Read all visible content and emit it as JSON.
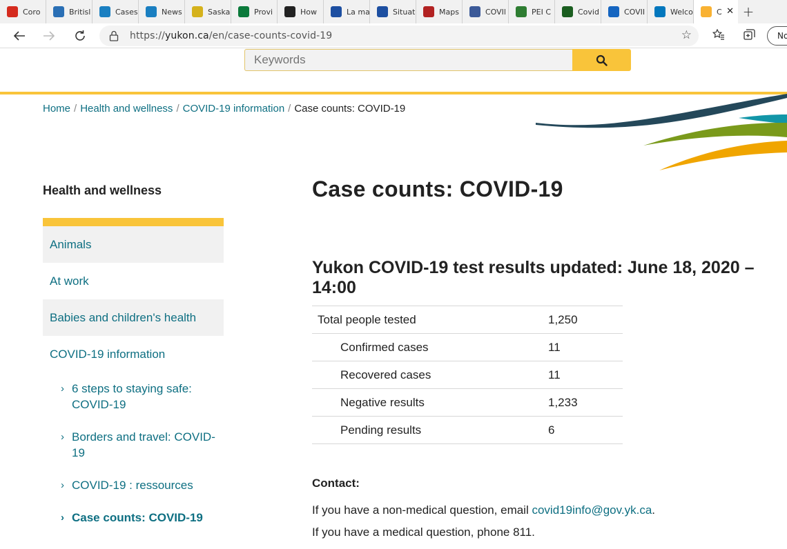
{
  "browser": {
    "tabs": [
      {
        "label": "Coro",
        "icon": "maple-leaf-icon",
        "color": "#d52b1e"
      },
      {
        "label": "Britisl",
        "icon": "bc-icon",
        "color": "#2a6fb5"
      },
      {
        "label": "Cases",
        "icon": "alberta-icon",
        "color": "#1a7fc1"
      },
      {
        "label": "News",
        "icon": "alberta-icon",
        "color": "#1a7fc1"
      },
      {
        "label": "Saska",
        "icon": "saskatchewan-icon",
        "color": "#d5b21c"
      },
      {
        "label": "Provi",
        "icon": "manitoba-icon",
        "color": "#0b7a3b"
      },
      {
        "label": "How",
        "icon": "ontario-icon",
        "color": "#222222"
      },
      {
        "label": "La ma",
        "icon": "quebec-icon",
        "color": "#1d4fa1"
      },
      {
        "label": "Situat",
        "icon": "quebec-icon",
        "color": "#1d4fa1"
      },
      {
        "label": "Maps",
        "icon": "new-brunswick-icon",
        "color": "#b22222"
      },
      {
        "label": "COVIl",
        "icon": "nova-scotia-icon",
        "color": "#3b5998"
      },
      {
        "label": "PEI C",
        "icon": "pei-icon",
        "color": "#2e7d32"
      },
      {
        "label": "Covid",
        "icon": "newfoundland-icon",
        "color": "#1b5e20"
      },
      {
        "label": "COVII",
        "icon": "nwt-icon",
        "color": "#1565c0"
      },
      {
        "label": "Welco",
        "icon": "nunavut-icon",
        "color": "#0277bd"
      },
      {
        "label": "C",
        "icon": "yukon-icon",
        "color": "#f9b233",
        "active": true
      }
    ],
    "new_tab": "+",
    "close_tab": "✕",
    "url_prefix": "https://",
    "url_domain": "yukon.ca",
    "url_path": "/en/case-counts-covid-19",
    "profile_label": "No"
  },
  "search": {
    "placeholder": "Keywords"
  },
  "breadcrumb": [
    {
      "label": "Home",
      "link": true
    },
    {
      "label": "Health and wellness",
      "link": true
    },
    {
      "label": "COVID-19 information",
      "link": true
    },
    {
      "label": "Case counts: COVID-19",
      "link": false
    }
  ],
  "sidebar": {
    "title": "Health and wellness",
    "items": [
      {
        "label": "Animals",
        "shaded": true
      },
      {
        "label": "At work",
        "shaded": false
      },
      {
        "label": "Babies and children's health",
        "shaded": true
      },
      {
        "label": "COVID-19 information",
        "shaded": false
      }
    ],
    "subitems": [
      {
        "line1": "6 steps to staying safe:",
        "line2": "COVID-19"
      },
      {
        "line1": "Borders and travel: COVID-",
        "line2": "19"
      },
      {
        "line1": "COVID-19 : ressources",
        "line2": ""
      },
      {
        "line1": "Case counts: COVID-19",
        "line2": "",
        "current": true
      }
    ]
  },
  "main": {
    "title": "Case counts: COVID-19",
    "subtitle_line1": "Yukon COVID-19 test results updated: June 18, 2020 –",
    "subtitle_line2": "14:00",
    "stats": [
      {
        "label": "Total people tested",
        "value": "1,250",
        "indent": false
      },
      {
        "label": "Confirmed cases",
        "value": "11",
        "indent": true
      },
      {
        "label": "Recovered cases",
        "value": "11",
        "indent": true
      },
      {
        "label": "Negative results",
        "value": "1,233",
        "indent": true
      },
      {
        "label": "Pending results",
        "value": "6",
        "indent": true
      }
    ],
    "contact_heading": "Contact:",
    "contact_line1_prefix": "If you have a non-medical question, email ",
    "contact_email": "covid19info@gov.yk.ca",
    "contact_line1_suffix": ".",
    "contact_line2": "If you have a medical question, phone 811."
  },
  "colors": {
    "brand_gold": "#f9c43a",
    "link_teal": "#0e6f82",
    "swoosh_dark": "#24485a",
    "swoosh_teal": "#1296a8",
    "swoosh_green": "#7a9a1b",
    "swoosh_orange": "#f0a500"
  }
}
